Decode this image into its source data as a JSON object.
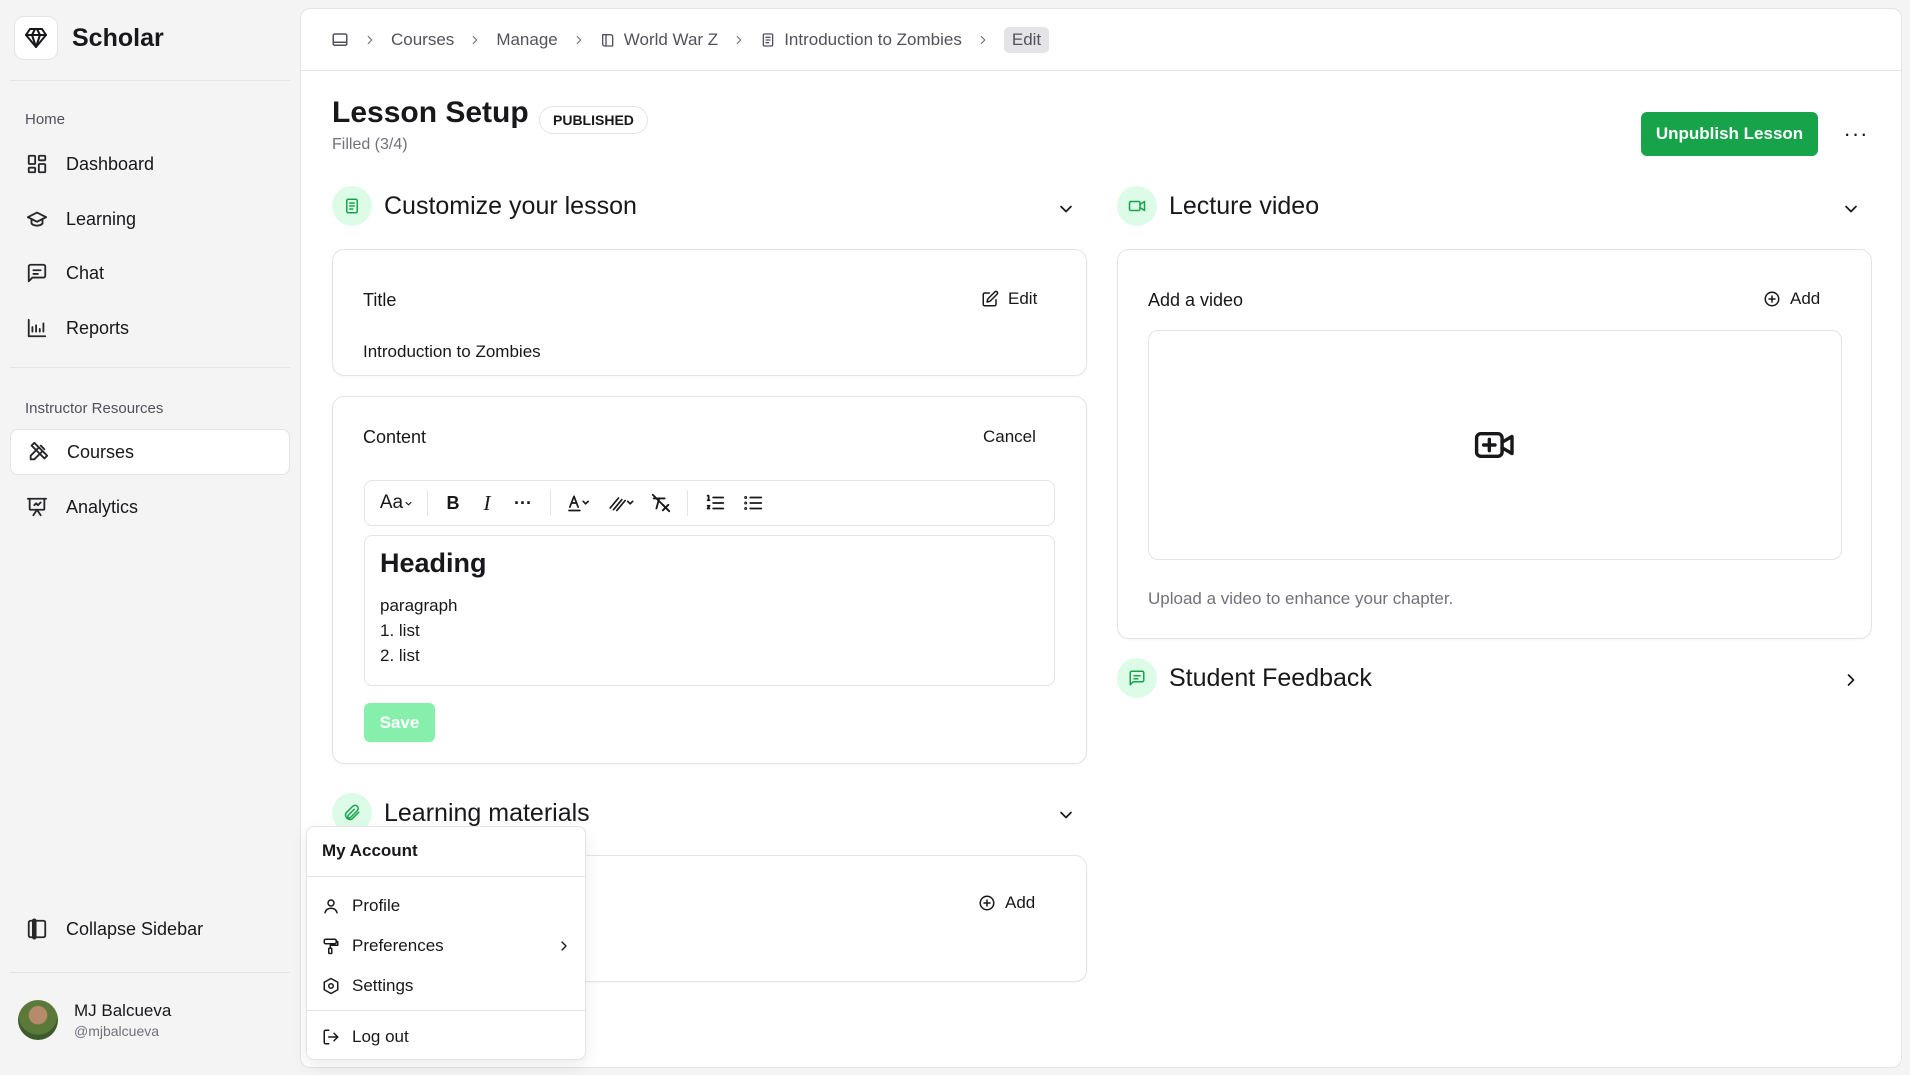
{
  "brand": {
    "name": "Scholar"
  },
  "sidebar": {
    "groups": [
      {
        "label": "Home",
        "items": [
          {
            "label": "Dashboard",
            "icon": "dashboard-icon"
          },
          {
            "label": "Learning",
            "icon": "graduation-cap-icon"
          },
          {
            "label": "Chat",
            "icon": "chat-icon"
          },
          {
            "label": "Reports",
            "icon": "chart-icon"
          }
        ]
      },
      {
        "label": "Instructor Resources",
        "items": [
          {
            "label": "Courses",
            "icon": "pencil-ruler-icon",
            "active": true
          },
          {
            "label": "Analytics",
            "icon": "presentation-icon"
          }
        ]
      }
    ],
    "collapse_label": "Collapse Sidebar",
    "user": {
      "name": "MJ Balcueva",
      "handle": "@mjbalcueva"
    }
  },
  "breadcrumb": [
    "Courses",
    "Manage",
    "World War Z",
    "Introduction to Zombies",
    "Edit"
  ],
  "header": {
    "title": "Lesson Setup",
    "status": "PUBLISHED",
    "filled": "Filled (3/4)",
    "unpublish_label": "Unpublish Lesson",
    "more_label": "···"
  },
  "customize": {
    "heading": "Customize your lesson",
    "title_card": {
      "label": "Title",
      "action": "Edit",
      "value": "Introduction to Zombies"
    },
    "content_card": {
      "label": "Content",
      "action": "Cancel",
      "editor": {
        "heading": "Heading",
        "paragraph": "paragraph",
        "list": [
          "1. list",
          "2. list"
        ]
      },
      "save_label": "Save"
    }
  },
  "materials": {
    "heading": "Learning materials",
    "action": "Add"
  },
  "video": {
    "heading": "Lecture video",
    "card_label": "Add a video",
    "action": "Add",
    "hint": "Upload a video to enhance your chapter."
  },
  "feedback": {
    "heading": "Student Feedback"
  },
  "account_menu": {
    "title": "My Account",
    "items": [
      {
        "label": "Profile",
        "icon": "user-icon"
      },
      {
        "label": "Preferences",
        "icon": "paint-roller-icon"
      },
      {
        "label": "Settings",
        "icon": "settings-icon"
      },
      {
        "label": "Log out",
        "icon": "logout-icon"
      }
    ]
  },
  "colors": {
    "accent": "#16a34a",
    "accent_soft": "#dcfce7",
    "save_disabled": "#86efac"
  }
}
